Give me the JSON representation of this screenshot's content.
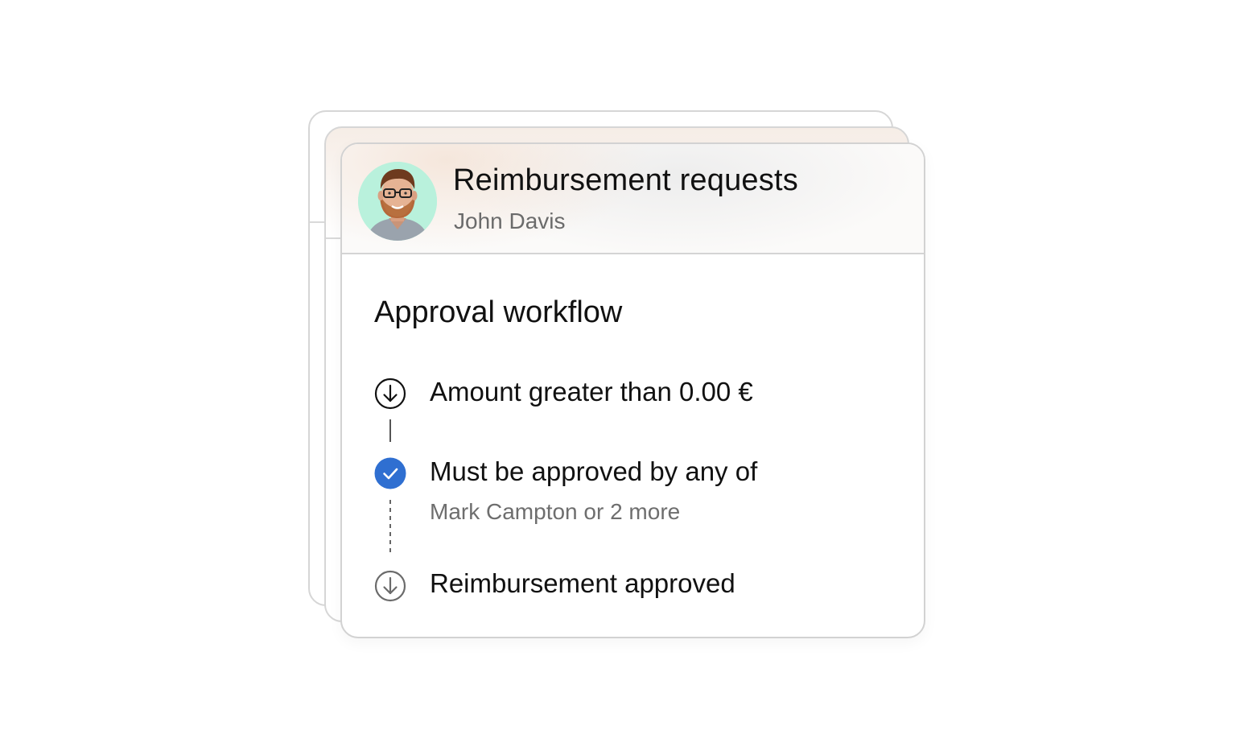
{
  "header": {
    "title": "Reimbursement requests",
    "subtitle": "John Davis"
  },
  "workflow": {
    "title": "Approval workflow",
    "steps": [
      {
        "label": "Amount greater than 0.00 €",
        "icon": "arrow-down-circle-icon",
        "state": "default"
      },
      {
        "label": "Must be approved by any of",
        "sublabel": "Mark Campton or 2 more",
        "icon": "check-circle-icon",
        "state": "completed"
      },
      {
        "label": "Reimbursement approved",
        "icon": "arrow-down-circle-icon",
        "state": "pending"
      }
    ]
  },
  "colors": {
    "accent": "#2f6fd1",
    "avatar_bg": "#b9f1dc",
    "text_primary": "#111111",
    "text_secondary": "#6b6b6b",
    "border": "#d2d2d2"
  }
}
